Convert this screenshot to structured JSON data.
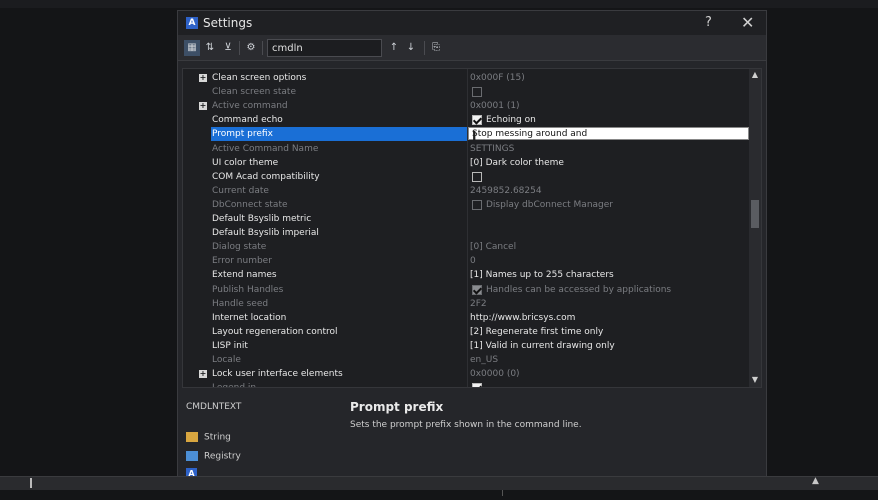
{
  "window": {
    "title": "Settings",
    "help_glyph": "?",
    "close_glyph": "✕",
    "app_glyph": "A"
  },
  "toolbar": {
    "search_value": "cmdln",
    "tools": [
      {
        "name": "categorized-view-icon",
        "glyph": "▦"
      },
      {
        "name": "alphabetical-sort-icon",
        "glyph": "⇅"
      },
      {
        "name": "filter-icon",
        "glyph": "⊻"
      },
      {
        "name": "settings-gear-icon",
        "glyph": "⚙"
      }
    ],
    "prev_glyph": "↑",
    "next_glyph": "↓",
    "export_glyph": "⎘"
  },
  "grid": {
    "rows": [
      {
        "name": "Clean screen options",
        "value": "0x000F (15)",
        "style": "bright",
        "expander": true,
        "value_dim": true
      },
      {
        "name": "Clean screen state",
        "value": "",
        "style": "dim",
        "check": "off-dim"
      },
      {
        "name": "Active command",
        "value": "0x0001 (1)",
        "style": "dim",
        "expander": true
      },
      {
        "name": "Command echo",
        "value": "Echoing on",
        "style": "bright",
        "check": "on"
      },
      {
        "name": "Prompt prefix",
        "value": "Stop messing around and ",
        "style": "selected",
        "editing": true
      },
      {
        "name": "Active Command Name",
        "value": "SETTINGS",
        "style": "dim"
      },
      {
        "name": "UI color theme",
        "value": "[0] Dark color theme",
        "style": "bright"
      },
      {
        "name": "COM Acad compatibility",
        "value": "",
        "style": "bright",
        "check": "off"
      },
      {
        "name": "Current date",
        "value": "2459852.68254",
        "style": "dim"
      },
      {
        "name": "DbConnect state",
        "value": "Display dbConnect Manager",
        "style": "dim",
        "check": "off-dim"
      },
      {
        "name": "Default Bsyslib metric",
        "value": "",
        "style": "bright"
      },
      {
        "name": "Default Bsyslib imperial",
        "value": "",
        "style": "bright"
      },
      {
        "name": "Dialog state",
        "value": "[0] Cancel",
        "style": "dim"
      },
      {
        "name": "Error number",
        "value": "0",
        "style": "dim"
      },
      {
        "name": "Extend names",
        "value": "[1] Names up to 255 characters",
        "style": "bright"
      },
      {
        "name": "Publish Handles",
        "value": "Handles can be accessed by applications",
        "style": "dim",
        "check": "on-dim"
      },
      {
        "name": "Handle seed",
        "value": "2F2",
        "style": "dim"
      },
      {
        "name": "Internet location",
        "value": "http://www.bricsys.com",
        "style": "bright"
      },
      {
        "name": "Layout regeneration control",
        "value": "[2] Regenerate first time only",
        "style": "bright"
      },
      {
        "name": "LISP init",
        "value": "[1] Valid in current drawing only",
        "style": "bright"
      },
      {
        "name": "Locale",
        "value": "en_US",
        "style": "dim"
      },
      {
        "name": "Lock user interface elements",
        "value": "0x0000 (0)",
        "style": "bright",
        "expander": true,
        "value_dim": true
      },
      {
        "name": "Legend in",
        "value": "",
        "style": "dim",
        "check": "on"
      }
    ]
  },
  "info": {
    "variable_key": "CMDLNTEXT",
    "title": "Prompt prefix",
    "description": "Sets the prompt prefix shown in the command line.",
    "type_label": "String",
    "storage_label": "Registry"
  },
  "scroll": {
    "up_glyph": "▲",
    "down_glyph": "▼"
  },
  "statusbar": {
    "arrow_glyph": "▲"
  }
}
